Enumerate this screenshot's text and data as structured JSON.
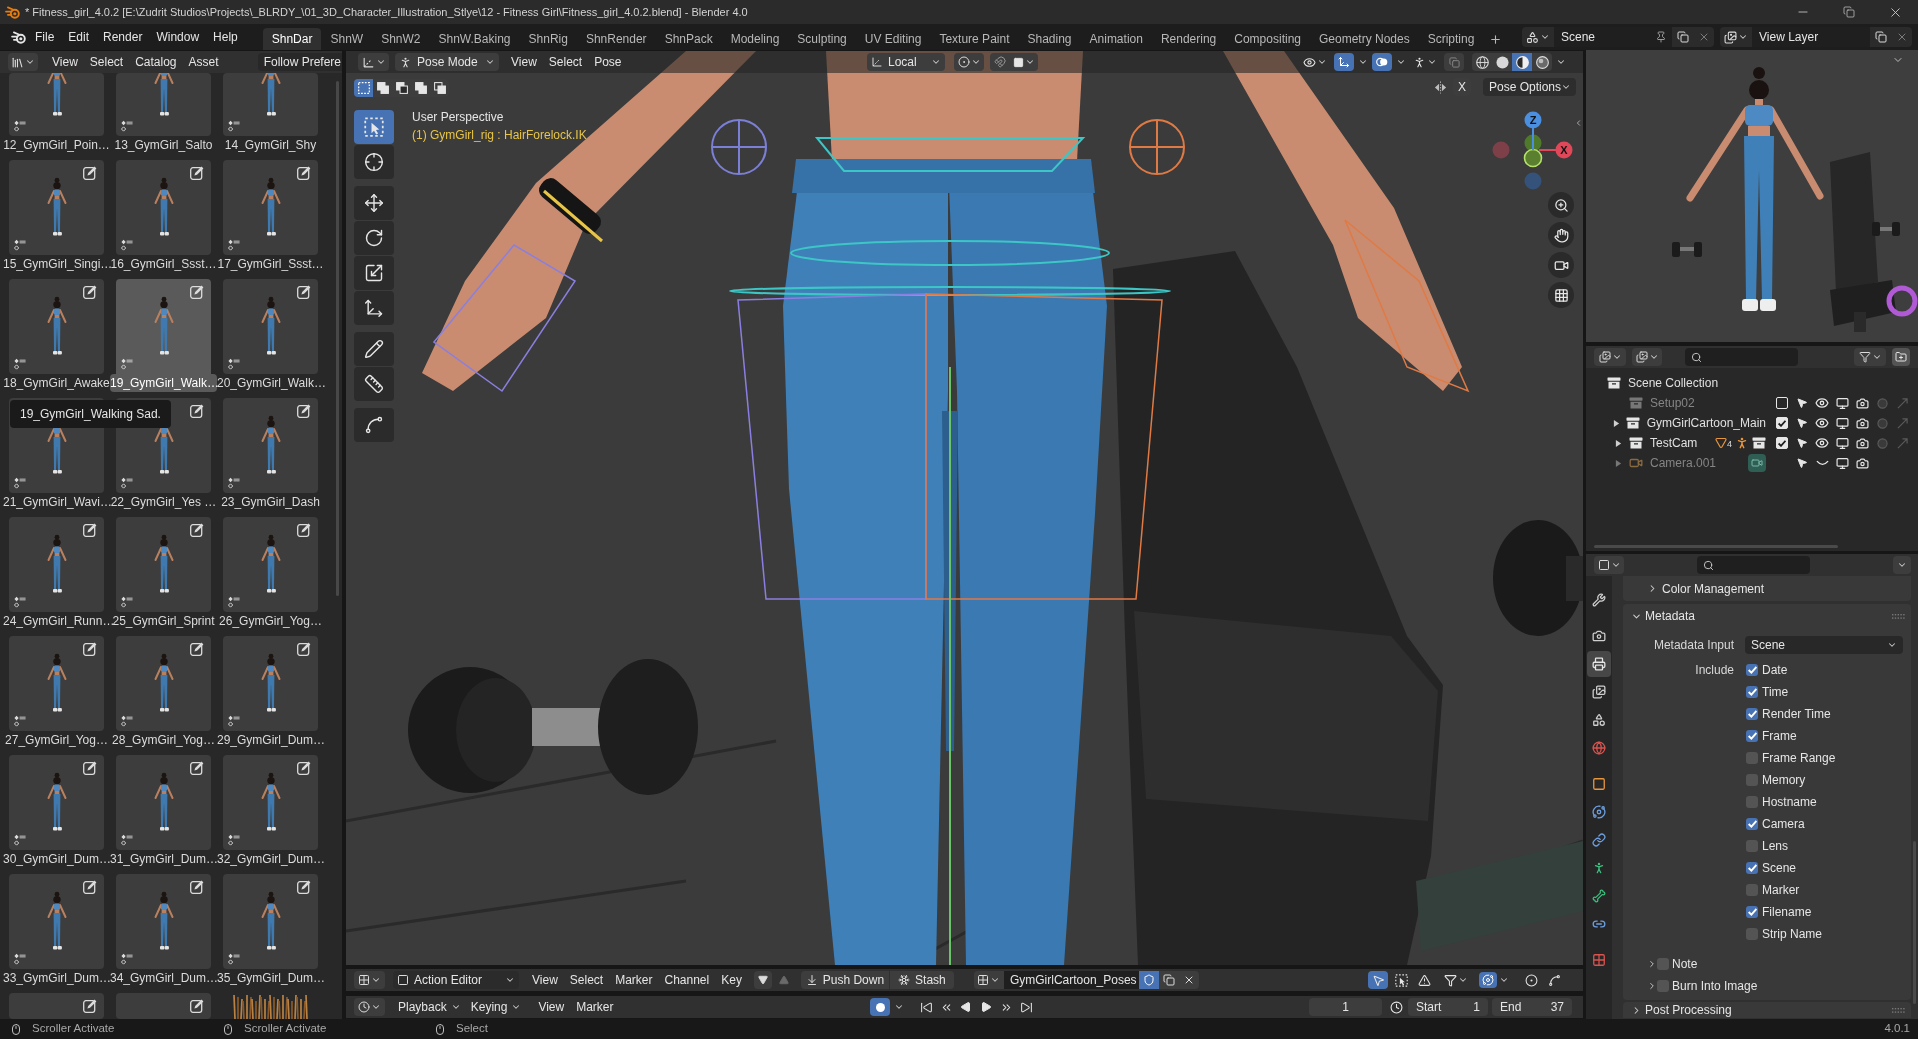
{
  "window": {
    "title": "* Fitness_girl_4.0.2 [E:\\Zudrit Studios\\Projects\\_BLRDY_\\01_3D_Character_Illustration_Stlye\\12 - Fitness Girl\\Fitness_girl_4.0.2.blend] - Blender 4.0"
  },
  "menu": [
    "File",
    "Edit",
    "Render",
    "Window",
    "Help"
  ],
  "workspaces": [
    {
      "label": "ShnDar",
      "selected": true
    },
    {
      "label": "ShnW",
      "selected": false
    },
    {
      "label": "ShnW2",
      "selected": false
    },
    {
      "label": "ShnW.Baking",
      "selected": false
    },
    {
      "label": "ShnRig",
      "selected": false
    },
    {
      "label": "ShnRender",
      "selected": false
    },
    {
      "label": "ShnPack",
      "selected": false
    },
    {
      "label": "Modeling",
      "selected": false
    },
    {
      "label": "Sculpting",
      "selected": false
    },
    {
      "label": "UV Editing",
      "selected": false
    },
    {
      "label": "Texture Paint",
      "selected": false
    },
    {
      "label": "Shading",
      "selected": false
    },
    {
      "label": "Animation",
      "selected": false
    },
    {
      "label": "Rendering",
      "selected": false
    },
    {
      "label": "Compositing",
      "selected": false
    },
    {
      "label": "Geometry Nodes",
      "selected": false
    },
    {
      "label": "Scripting",
      "selected": false
    }
  ],
  "scene": "Scene",
  "view_layer": "View Layer",
  "asset_browser": {
    "menus": [
      "View",
      "Select",
      "Catalog",
      "Asset"
    ],
    "library": "Follow Prefere",
    "tooltip": "19_GymGirl_Walking Sad.",
    "assets": [
      {
        "label": "12_GymGirl_Poin…",
        "kind": "pose",
        "selected": false
      },
      {
        "label": "13_GymGirl_Salto",
        "kind": "pose",
        "selected": false
      },
      {
        "label": "14_GymGirl_Shy",
        "kind": "pose",
        "selected": false
      },
      {
        "label": "15_GymGirl_Singi…",
        "kind": "pose",
        "selected": false
      },
      {
        "label": "16_GymGirl_Ssst…",
        "kind": "pose",
        "selected": false
      },
      {
        "label": "17_GymGirl_Ssst…",
        "kind": "pose",
        "selected": false
      },
      {
        "label": "18_GymGirl_Awake",
        "kind": "pose",
        "selected": false
      },
      {
        "label": "19_GymGirl_Walk…",
        "kind": "pose",
        "selected": true
      },
      {
        "label": "20_GymGirl_Walk…",
        "kind": "pose",
        "selected": false
      },
      {
        "label": "21_GymGirl_Wavi…",
        "kind": "pose",
        "selected": false
      },
      {
        "label": "22_GymGirl_Yes …",
        "kind": "pose",
        "selected": false
      },
      {
        "label": "23_GymGirl_Dash",
        "kind": "pose",
        "selected": false
      },
      {
        "label": "24_GymGirl_Runn…",
        "kind": "pose",
        "selected": false
      },
      {
        "label": "25_GymGirl_Sprint",
        "kind": "pose",
        "selected": false
      },
      {
        "label": "26_GymGirl_Yog…",
        "kind": "pose",
        "selected": false
      },
      {
        "label": "27_GymGirl_Yog…",
        "kind": "pose",
        "selected": false
      },
      {
        "label": "28_GymGirl_Yog…",
        "kind": "pose",
        "selected": false
      },
      {
        "label": "29_GymGirl_Dum…",
        "kind": "pose",
        "selected": false
      },
      {
        "label": "30_GymGirl_Dum…",
        "kind": "pose",
        "selected": false
      },
      {
        "label": "31_GymGirl_Dum…",
        "kind": "pose",
        "selected": false
      },
      {
        "label": "32_GymGirl_Dum…",
        "kind": "pose",
        "selected": false
      },
      {
        "label": "33_GymGirl_Dum…",
        "kind": "pose",
        "selected": false
      },
      {
        "label": "34_GymGirl_Dum…",
        "kind": "pose",
        "selected": false
      },
      {
        "label": "35_GymGirl_Dum…",
        "kind": "pose",
        "selected": false
      },
      {
        "kind": "pose",
        "selected": false
      },
      {
        "kind": "pose",
        "selected": false
      },
      {
        "kind": "image",
        "selected": false
      }
    ]
  },
  "viewport": {
    "mode": "Pose Mode",
    "menus": [
      "View",
      "Select",
      "Pose"
    ],
    "orientation": "Local",
    "gizmos_on": true,
    "overlays_on": true,
    "shading": [
      {
        "kind": "wireframe",
        "selected": false
      },
      {
        "kind": "solid",
        "selected": false
      },
      {
        "kind": "material",
        "selected": true
      },
      {
        "kind": "rendered",
        "selected": false
      }
    ],
    "select_modes": [
      {
        "kind": "set",
        "selected": true
      },
      {
        "kind": "extend",
        "selected": false
      },
      {
        "kind": "subtract",
        "selected": false
      },
      {
        "kind": "difference",
        "selected": false
      },
      {
        "kind": "intersect",
        "selected": false
      }
    ],
    "mirror": "X",
    "options": "Pose Options",
    "view_name": "User Perspective",
    "active_bone": "(1) GymGirl_rig : HairForelock.IK",
    "tools": [
      {
        "kind": "select_box",
        "selected": true
      },
      {
        "kind": "cursor",
        "selected": false
      },
      {
        "kind": "move",
        "selected": false
      },
      {
        "kind": "rotate",
        "selected": false
      },
      {
        "kind": "scale",
        "selected": false
      },
      {
        "kind": "transform",
        "selected": false
      },
      {
        "kind": "annotate",
        "selected": false
      },
      {
        "kind": "measure",
        "selected": false
      },
      {
        "kind": "relax",
        "selected": false
      }
    ],
    "axis_labels": [
      "Z",
      "X"
    ]
  },
  "action_editor": {
    "mode": "Action Editor",
    "menus": [
      "View",
      "Select",
      "Marker",
      "Channel",
      "Key"
    ],
    "push_down": "Push Down",
    "stash": "Stash",
    "action": "GymGirlCartoon_Poses",
    "fake_user": true
  },
  "timeline": {
    "dropdowns": [
      "Playback",
      "Keying"
    ],
    "menus": [
      "View",
      "Marker"
    ],
    "auto_keying": true,
    "frame": "1",
    "start_label": "Start",
    "start": "1",
    "end_label": "End",
    "end": "37"
  },
  "outliner": {
    "items": [
      {
        "label": "Scene Collection",
        "kind": "scene_collection",
        "children": [
          {
            "label": "Setup02",
            "kind": "collection",
            "has_children": false,
            "checked": false,
            "visible": true
          },
          {
            "label": "GymGirlCartoon_Main",
            "kind": "collection",
            "has_children": true,
            "checked": true,
            "visible": true
          },
          {
            "label": "TestCam",
            "kind": "collection",
            "has_children": true,
            "checked": true,
            "visible": true,
            "badges": [
              {
                "kind": "mesh",
                "count": "4"
              },
              {
                "kind": "armature"
              },
              {
                "kind": "collection"
              }
            ]
          },
          {
            "label": "Camera.001",
            "kind": "camera",
            "has_children": true,
            "visible": false,
            "badges": [
              {
                "kind": "camera_data"
              }
            ]
          }
        ]
      }
    ]
  },
  "properties": {
    "tabs": [
      {
        "kind": "tool",
        "selected": false
      },
      {
        "kind": "render",
        "selected": false
      },
      {
        "kind": "output",
        "selected": true
      },
      {
        "kind": "view_layer",
        "selected": false
      },
      {
        "kind": "scene",
        "selected": false
      },
      {
        "kind": "world",
        "selected": false
      },
      {
        "kind": "object",
        "selected": false
      },
      {
        "kind": "physics",
        "selected": false
      },
      {
        "kind": "constraints",
        "selected": false
      },
      {
        "kind": "data",
        "selected": false
      },
      {
        "kind": "bone",
        "selected": false
      },
      {
        "kind": "bone_constraints",
        "selected": false
      },
      {
        "kind": "texture",
        "selected": false
      }
    ],
    "panels": [
      {
        "label": "Color Management",
        "kind": "subpanel",
        "expanded": false
      },
      {
        "label": "Metadata",
        "kind": "panel",
        "expanded": true,
        "input_label": "Metadata Input",
        "input": "Scene",
        "include_label": "Include",
        "include": [
          {
            "label": "Date",
            "checked": true
          },
          {
            "label": "Time",
            "checked": true
          },
          {
            "label": "Render Time",
            "checked": true
          },
          {
            "label": "Frame",
            "checked": true
          },
          {
            "label": "Frame Range",
            "checked": false
          },
          {
            "label": "Memory",
            "checked": false
          },
          {
            "label": "Hostname",
            "checked": false
          },
          {
            "label": "Camera",
            "checked": true
          },
          {
            "label": "Lens",
            "checked": false
          },
          {
            "label": "Scene",
            "checked": true
          },
          {
            "label": "Marker",
            "checked": false
          },
          {
            "label": "Filename",
            "checked": true
          },
          {
            "label": "Strip Name",
            "checked": false
          }
        ],
        "subpanels": [
          {
            "label": "Note",
            "checked": false,
            "expanded": false
          },
          {
            "label": "Burn Into Image",
            "checked": false,
            "expanded": false
          }
        ]
      },
      {
        "label": "Post Processing",
        "kind": "panel",
        "expanded": false
      }
    ]
  },
  "status_bar": {
    "hints": [
      "Scroller Activate",
      "Scroller Activate",
      "Select"
    ],
    "version": "4.0.1"
  }
}
